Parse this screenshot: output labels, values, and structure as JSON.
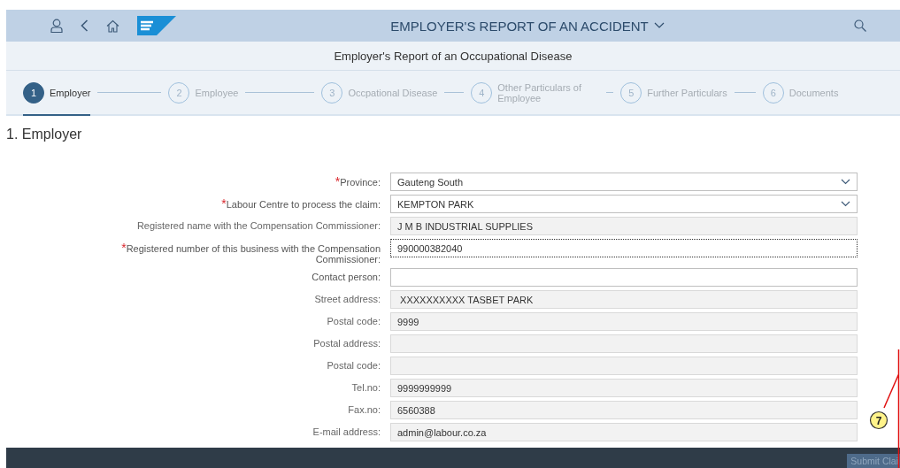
{
  "shell": {
    "title": "EMPLOYER'S REPORT OF AN ACCIDENT"
  },
  "subtitle": "Employer's Report of an Occupational Disease",
  "steps": [
    {
      "number": "1",
      "label": "Employer",
      "selected": true
    },
    {
      "number": "2",
      "label": "Employee",
      "selected": false
    },
    {
      "number": "3",
      "label": "Occpational Disease",
      "selected": false
    },
    {
      "number": "4",
      "label": "Other Particulars of Employee",
      "selected": false
    },
    {
      "number": "5",
      "label": "Further Particulars",
      "selected": false
    },
    {
      "number": "6",
      "label": "Documents",
      "selected": false
    }
  ],
  "section_title": "1. Employer",
  "required_mark": "*",
  "fields": [
    {
      "label": "Province:",
      "required": true,
      "kind": "select",
      "value": "Gauteng South",
      "readonly": false,
      "focused": false
    },
    {
      "label": "Labour Centre to process the claim:",
      "required": true,
      "kind": "select",
      "value": "KEMPTON PARK",
      "readonly": false,
      "focused": false
    },
    {
      "label": "Registered name with the Compensation Commissioner:",
      "required": false,
      "kind": "text",
      "value": "J M B INDUSTRIAL SUPPLIES",
      "readonly": true,
      "focused": false
    },
    {
      "label": "Registered number of this business with the Compensation Commissioner:",
      "required": true,
      "kind": "text",
      "value": "990000382040",
      "readonly": false,
      "focused": true
    },
    {
      "label": "Contact person:",
      "required": false,
      "kind": "text",
      "readonly": false,
      "focused": false
    },
    {
      "label": "Street address:",
      "required": false,
      "kind": "text",
      "value": " XXXXXXXXXX TASBET PARK",
      "readonly": true,
      "focused": false
    },
    {
      "label": "Postal code:",
      "required": false,
      "kind": "text",
      "value": "9999",
      "readonly": true,
      "focused": false
    },
    {
      "label": "Postal address:",
      "required": false,
      "kind": "text",
      "readonly": true,
      "focused": false
    },
    {
      "label": "Postal code:",
      "required": false,
      "kind": "text",
      "readonly": true,
      "focused": false
    },
    {
      "label": "Tel.no:",
      "required": false,
      "kind": "text",
      "value": "9999999999",
      "readonly": true,
      "focused": false
    },
    {
      "label": "Fax.no:",
      "required": false,
      "kind": "text",
      "value": "6560388",
      "readonly": true,
      "focused": false
    },
    {
      "label": "E-mail address:",
      "required": false,
      "kind": "text",
      "value": "admin@labour.co.za",
      "readonly": true,
      "focused": false
    }
  ],
  "callout": "7",
  "footer": {
    "submit_button": "Submit Clai"
  }
}
